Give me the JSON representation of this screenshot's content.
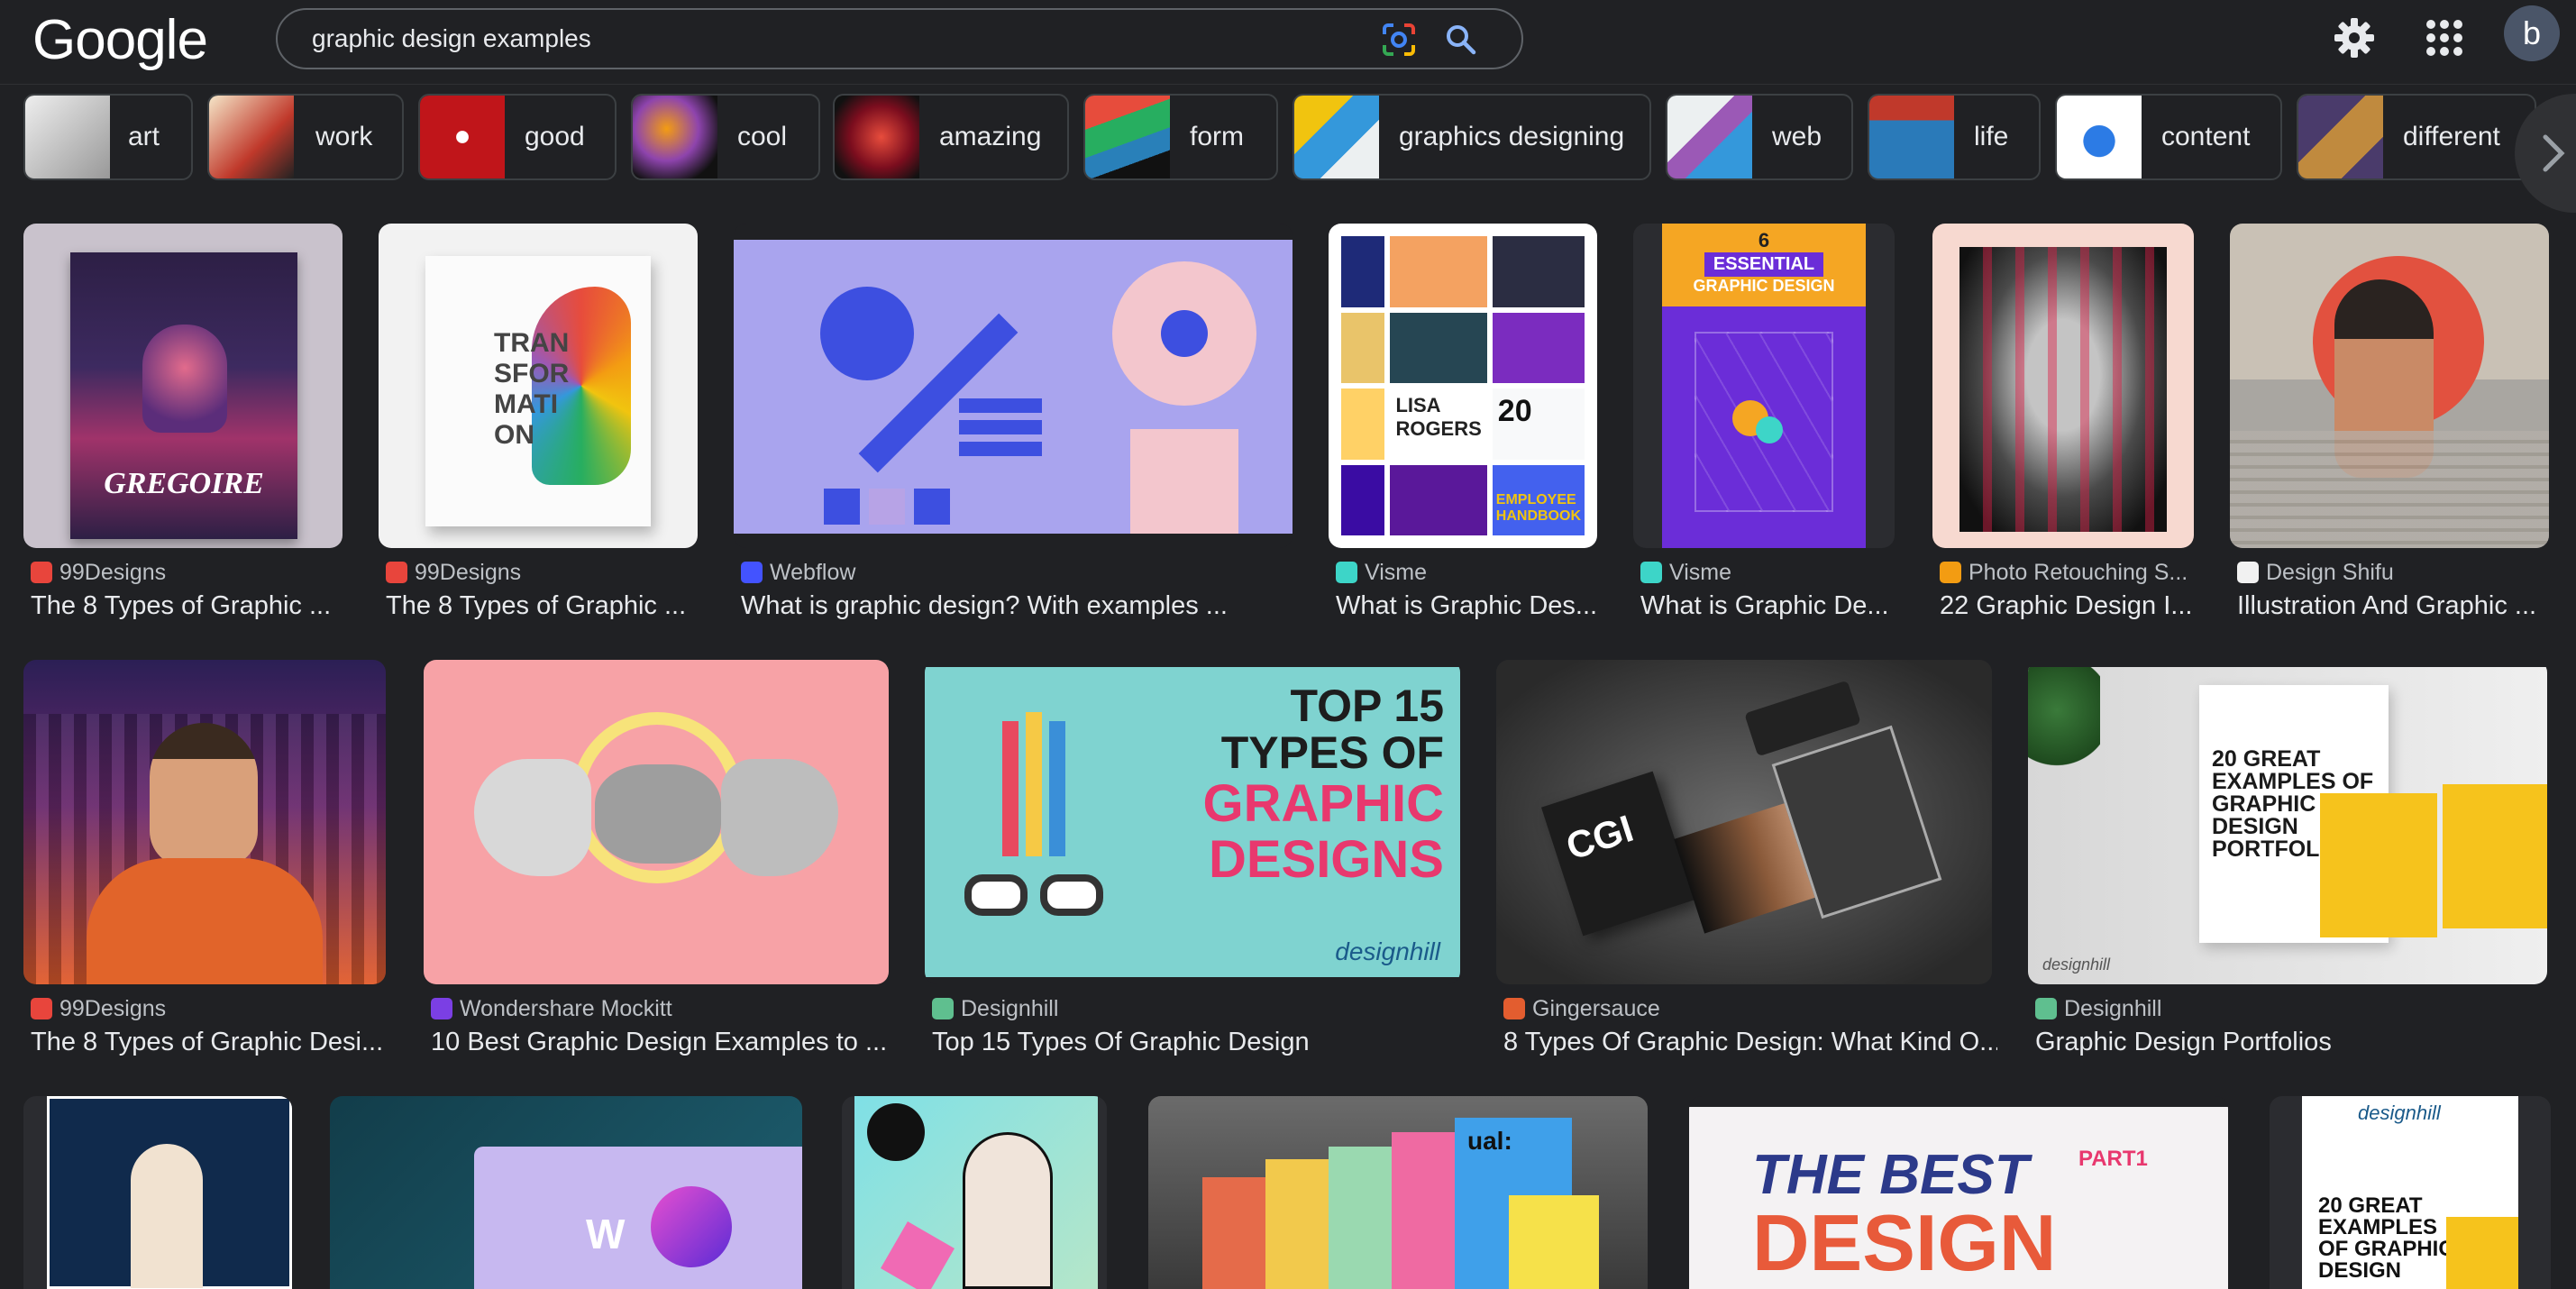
{
  "header": {
    "logo": "Google",
    "search_value": "graphic design examples",
    "avatar_letter": "b"
  },
  "chips": [
    {
      "label": "art"
    },
    {
      "label": "work"
    },
    {
      "label": "good"
    },
    {
      "label": "cool"
    },
    {
      "label": "amazing"
    },
    {
      "label": "form"
    },
    {
      "label": "graphics designing"
    },
    {
      "label": "web"
    },
    {
      "label": "life"
    },
    {
      "label": "content"
    },
    {
      "label": "different"
    }
  ],
  "results": [
    {
      "source": "99Designs",
      "title": "The 8 Types of Graphic ..."
    },
    {
      "source": "99Designs",
      "title": "The 8 Types of Graphic ..."
    },
    {
      "source": "Webflow",
      "title": "What is graphic design? With examples ..."
    },
    {
      "source": "Visme",
      "title": "What is Graphic Des..."
    },
    {
      "source": "Visme",
      "title": "What is Graphic De..."
    },
    {
      "source": "Photo Retouching S...",
      "title": "22 Graphic Design I..."
    },
    {
      "source": "Design Shifu",
      "title": "Illustration And Graphic ..."
    },
    {
      "source": "99Designs",
      "title": "The 8 Types of Graphic Desi..."
    },
    {
      "source": "Wondershare Mockitt",
      "title": "10 Best Graphic Design Examples to ..."
    },
    {
      "source": "Designhill",
      "title": "Top 15 Types Of Graphic Design"
    },
    {
      "source": "Gingersauce",
      "title": "8 Types Of Graphic Design: What Kind O..."
    },
    {
      "source": "Designhill",
      "title": "Graphic Design Portfolios"
    }
  ],
  "image_text": {
    "gregoire": "GREGOIRE",
    "transformation": "TRAN SFOR MATI ON",
    "essential_num": "6",
    "essential": "ESSENTIAL",
    "essential_sub": "GRAPHIC DESIGN",
    "top15_a": "TOP 15",
    "top15_b": "TYPES OF",
    "top15_c": "GRAPHIC",
    "top15_d": "DESIGNS",
    "designhill": "designhill",
    "portfolio": "20 GREAT EXAMPLES OF GRAPHIC DESIGN PORTFOLIOS",
    "best_a": "THE BEST",
    "best_b": "DESIGN",
    "part1": "PART1",
    "cgi": "CGI",
    "ual": "ual:",
    "visme_lisa": "LISA ROGERS",
    "visme_20": "20",
    "employee": "EMPLOYEE HANDBOOK",
    "wix_w": "W",
    "portfolio2": "20 GREAT EXAMPLES OF GRAPHIC DESIGN"
  },
  "colors": {
    "background": "#202124",
    "chip_border": "#3c4043",
    "text_primary": "#e8eaed",
    "text_secondary": "#bdc1c6"
  }
}
